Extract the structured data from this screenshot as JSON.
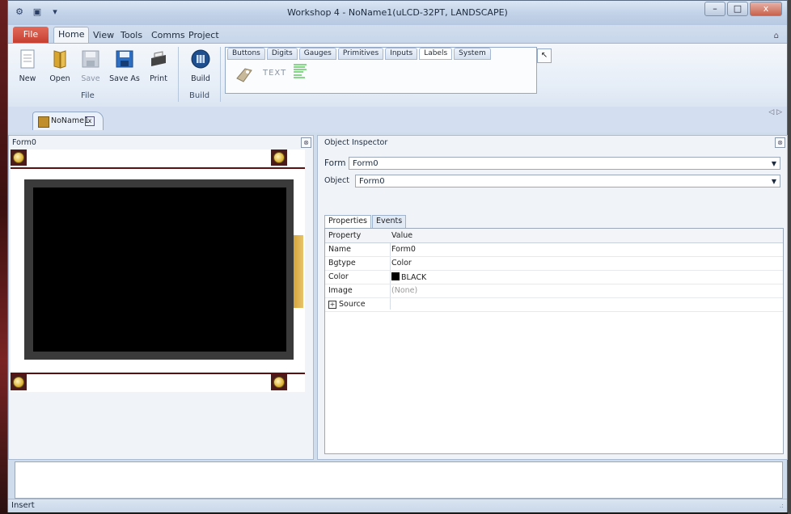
{
  "window": {
    "title": "Workshop 4 - NoName1(uLCD-32PT, LANDSCAPE)",
    "controls": {
      "minimize": "–",
      "maximize": "□",
      "close": "x"
    }
  },
  "quick_access": {
    "icons": [
      "wrench-icon",
      "save-icon",
      "dropdown-icon"
    ],
    "glyphs": [
      "⚙",
      "▣",
      "▾"
    ]
  },
  "ribbon_tabs": {
    "file": "File",
    "items": [
      "Home",
      "View",
      "Tools",
      "Comms",
      "Project"
    ],
    "active": "Home",
    "help_glyph": "⌂"
  },
  "home_ribbon": {
    "file_group": {
      "label": "File",
      "buttons": [
        {
          "label": "New",
          "icon": "new-document-icon",
          "enabled": true
        },
        {
          "label": "Open",
          "icon": "open-folder-icon",
          "enabled": true
        },
        {
          "label": "Save",
          "icon": "save-disk-icon",
          "enabled": false
        },
        {
          "label": "Save As",
          "icon": "save-as-icon",
          "enabled": true
        },
        {
          "label": "Print",
          "icon": "printer-icon",
          "enabled": true
        }
      ]
    },
    "build_group": {
      "label": "Build",
      "buttons": [
        {
          "label": "Build",
          "icon": "build-icon",
          "enabled": true
        }
      ]
    },
    "palette": {
      "tabs": [
        "Buttons",
        "Digits",
        "Gauges",
        "Primitives",
        "Inputs",
        "Labels",
        "System"
      ],
      "active": "Labels",
      "items": [
        "tag-label-icon",
        "text-label-icon",
        "string-label-icon"
      ],
      "text_item": "TEXT",
      "pointer_glyph": "↖"
    }
  },
  "document": {
    "tab_label": "NoName1",
    "tab_close": "x",
    "scroll_glyphs": "◁ ▷"
  },
  "form_panel": {
    "title": "Form0",
    "close_glyph": "⊗",
    "screen_color": "#000000"
  },
  "inspector": {
    "title": "Object Inspector",
    "close_glyph": "⊗",
    "form_label": "Form",
    "form_value": "Form0",
    "object_label": "Object",
    "object_value": "Form0",
    "tabs": [
      "Properties",
      "Events"
    ],
    "active_tab": "Properties",
    "columns": [
      "Property",
      "Value"
    ],
    "rows": [
      {
        "property": "Name",
        "value": "Form0"
      },
      {
        "property": "Bgtype",
        "value": "Color"
      },
      {
        "property": "Color",
        "value": "BLACK",
        "swatch": "#000000"
      },
      {
        "property": "Image",
        "value": "(None)",
        "muted": true
      },
      {
        "property": "Source",
        "value": "",
        "expandable": true
      }
    ]
  },
  "status_bar": {
    "mode": "Insert",
    "grip": ".:"
  },
  "colors": {
    "accent": "#c63f30",
    "ribbon_bg": "#e5edf7",
    "panel_border": "#a9bad2"
  }
}
